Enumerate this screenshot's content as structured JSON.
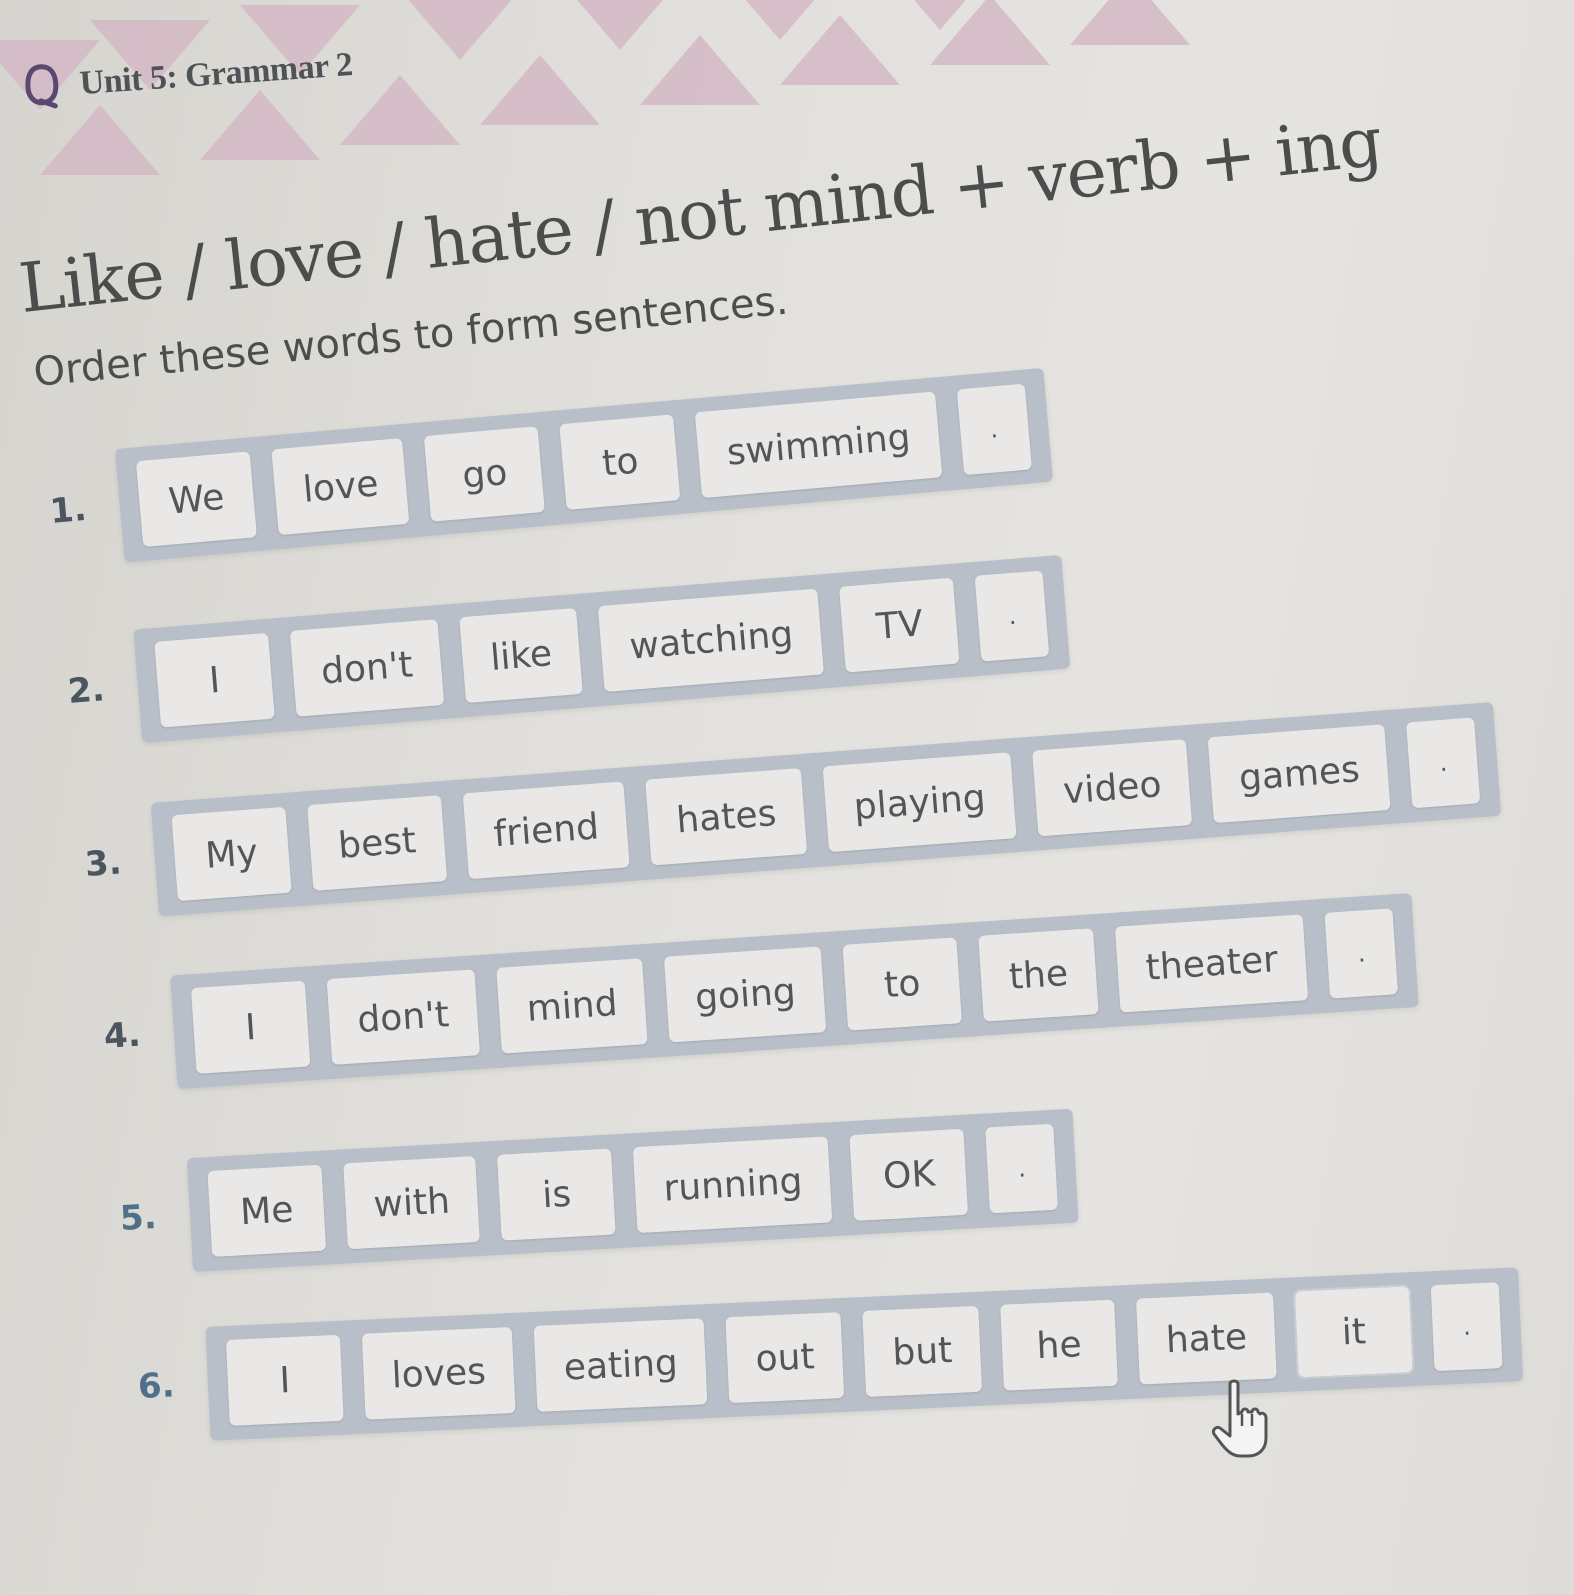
{
  "header": {
    "logo_icon": "q-logo-icon",
    "unit_title": "Unit 5: Grammar 2"
  },
  "main_title": "Like / love / hate / not mind + verb + ing",
  "instructions": "Order these words to form sentences.",
  "exercises": [
    {
      "number": "1.",
      "tiles": [
        "We",
        "love",
        "go",
        "to",
        "swimming",
        "."
      ]
    },
    {
      "number": "2.",
      "tiles": [
        "I",
        "don't",
        "like",
        "watching",
        "TV",
        "."
      ]
    },
    {
      "number": "3.",
      "tiles": [
        "My",
        "best",
        "friend",
        "hates",
        "playing",
        "video",
        "games",
        "."
      ]
    },
    {
      "number": "4.",
      "tiles": [
        "I",
        "don't",
        "mind",
        "going",
        "to",
        "the",
        "theater",
        "."
      ]
    },
    {
      "number": "5.",
      "tiles": [
        "Me",
        "with",
        "is",
        "running",
        "OK",
        "."
      ]
    },
    {
      "number": "6.",
      "tiles": [
        "I",
        "loves",
        "eating",
        "out",
        "but",
        "he",
        "hate",
        "it",
        "."
      ]
    }
  ],
  "cursor": {
    "icon": "hand-pointer-icon",
    "hovering_tile": "it"
  },
  "colors": {
    "banner_triangles": "#d3b9c4",
    "tray": "#b9bfc9",
    "tile": "#e9e8e6",
    "logo": "#5a4870",
    "number_accent": "#50708a"
  }
}
